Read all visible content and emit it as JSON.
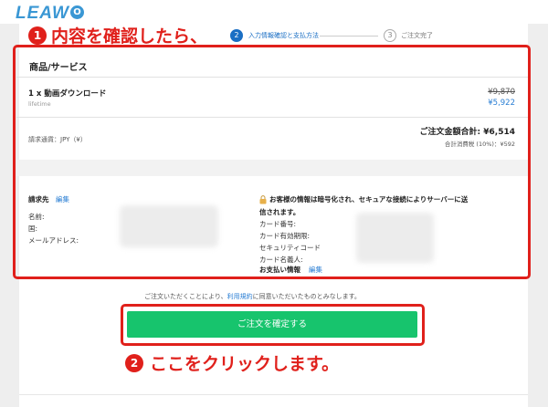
{
  "brand": {
    "logo_text": "LEAW",
    "logo_mark": "O"
  },
  "steps": [
    {
      "number": "2",
      "label": "入力情報確認と支払方法",
      "active": true
    },
    {
      "number": "3",
      "label": "ご注文完了",
      "active": false
    }
  ],
  "annotations": [
    {
      "number": "1",
      "text": "内容を確認したら、"
    },
    {
      "number": "2",
      "text": "ここをクリックします。"
    }
  ],
  "products": {
    "section_title": "商品/サービス",
    "item_name": "1 x 動画ダウンロード",
    "item_sub": "lifetime",
    "price_old": "¥9,870",
    "price_new": "¥5,922",
    "currency_label": "請求通貨：JPY（¥）",
    "total": "ご注文金額合計: ¥6,514",
    "tax": "合計消費税 (10%)：¥592"
  },
  "billing": {
    "title": "請求先",
    "edit": "編集",
    "fields": [
      "名前:",
      "国:",
      "メールアドレス:"
    ]
  },
  "payment": {
    "secure_notice_line1": "お客様の情報は暗号化され、セキュアな接続によりサーバーに送",
    "secure_notice_line2": "信されます。",
    "fields": [
      "カード番号:",
      "カード有効期限:",
      "セキュリティコード",
      "カード名義人:"
    ],
    "info_label": "お支払い情報",
    "edit": "編集"
  },
  "agreement": {
    "prefix": "ご注文いただくことにより、",
    "link": "利用規約",
    "suffix": "に同意いただいたものとみなします。"
  },
  "confirm_button": "ご注文を確定する",
  "colors": {
    "accent": "#1b6fc4",
    "annotation": "#e0201b",
    "button": "#17c46d",
    "link": "#2b7fd4"
  }
}
